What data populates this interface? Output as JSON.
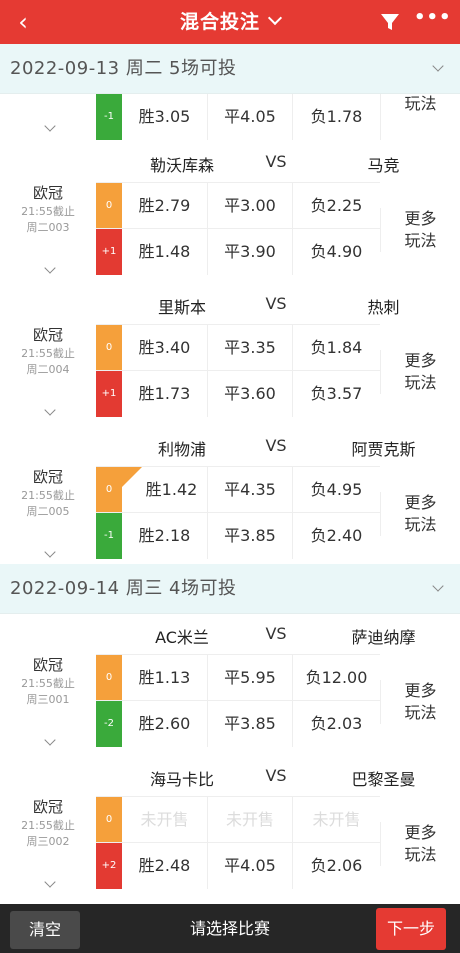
{
  "header": {
    "back_icon": "‹",
    "title": "混合投注",
    "filter_icon": "filter-icon",
    "more_icon": "•••"
  },
  "dates": [
    {
      "label": "2022-09-13  周二  5场可投"
    },
    {
      "label": "2022-09-14  周三  4场可投"
    }
  ],
  "partial_row": {
    "handicap": "-1",
    "win": "胜3.05",
    "draw": "平4.05",
    "lose": "负1.78",
    "more": "玩法"
  },
  "matches": [
    {
      "league": "欧冠",
      "deadline_time": "21:55截止",
      "match_no": "周二003",
      "home": "勒沃库森",
      "vs": "VS",
      "away": "马竞",
      "rows": [
        {
          "handicap": "0",
          "win": "胜2.79",
          "draw": "平3.00",
          "lose": "负2.25"
        },
        {
          "handicap": "+1",
          "win": "胜1.48",
          "draw": "平3.90",
          "lose": "负4.90"
        }
      ],
      "more_1": "更多",
      "more_2": "玩法"
    },
    {
      "league": "欧冠",
      "deadline_time": "21:55截止",
      "match_no": "周二004",
      "home": "里斯本",
      "vs": "VS",
      "away": "热刺",
      "rows": [
        {
          "handicap": "0",
          "win": "胜3.40",
          "draw": "平3.35",
          "lose": "负1.84"
        },
        {
          "handicap": "+1",
          "win": "胜1.73",
          "draw": "平3.60",
          "lose": "负3.57"
        }
      ],
      "more_1": "更多",
      "more_2": "玩法"
    },
    {
      "league": "欧冠",
      "deadline_time": "21:55截止",
      "match_no": "周二005",
      "home": "利物浦",
      "vs": "VS",
      "away": "阿贾克斯",
      "rows": [
        {
          "handicap": "0",
          "win": "胜1.42",
          "draw": "平4.35",
          "lose": "负4.95"
        },
        {
          "handicap": "-1",
          "win": "胜2.18",
          "draw": "平3.85",
          "lose": "负2.40"
        }
      ],
      "more_1": "更多",
      "more_2": "玩法"
    },
    {
      "league": "欧冠",
      "deadline_time": "21:55截止",
      "match_no": "周三001",
      "home": "AC米兰",
      "vs": "VS",
      "away": "萨迪纳摩",
      "rows": [
        {
          "handicap": "0",
          "win": "胜1.13",
          "draw": "平5.95",
          "lose": "负12.00"
        },
        {
          "handicap": "-2",
          "win": "胜2.60",
          "draw": "平3.85",
          "lose": "负2.03"
        }
      ],
      "more_1": "更多",
      "more_2": "玩法"
    },
    {
      "league": "欧冠",
      "deadline_time": "21:55截止",
      "match_no": "周三002",
      "home": "海马卡比",
      "vs": "VS",
      "away": "巴黎圣曼",
      "rows": [
        {
          "handicap": "0",
          "win": "未开售",
          "draw": "未开售",
          "lose": "未开售"
        },
        {
          "handicap": "+2",
          "win": "胜2.48",
          "draw": "平4.05",
          "lose": "负2.06"
        }
      ],
      "more_1": "更多",
      "more_2": "玩法"
    }
  ],
  "footer": {
    "clear": "清空",
    "hint": "请选择比赛",
    "next": "下一步"
  },
  "colors": {
    "brand_red": "#e53a33",
    "handicap_orange": "#f5a03b",
    "handicap_green": "#3aaa3b",
    "date_bar_bg": "#eaf7f8"
  }
}
